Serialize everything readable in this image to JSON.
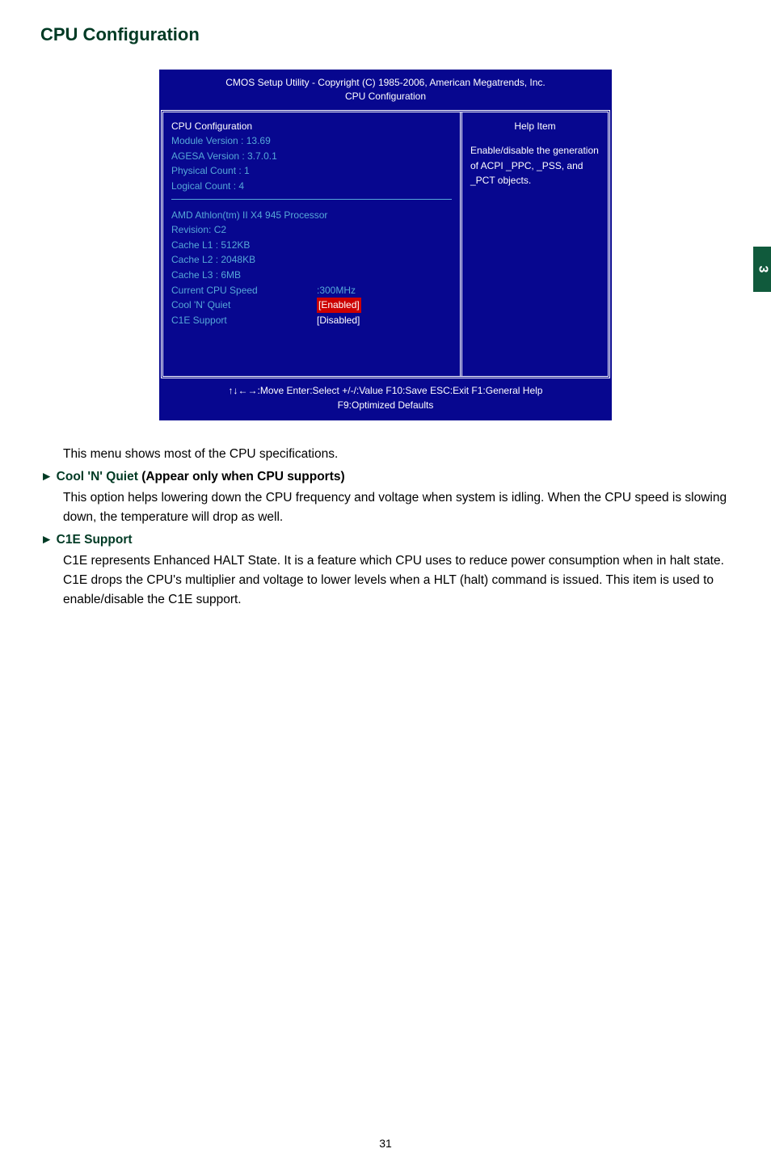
{
  "title": "CPU Configuration",
  "bios": {
    "header_line1": "CMOS Setup Utility - Copyright (C) 1985-2006, American Megatrends, Inc.",
    "header_line2": "CPU Configuration",
    "left": {
      "section_title": "CPU Configuration",
      "module_version": "Module  Version :  13.69",
      "agesa_version": "AGESA  Version :  3.7.0.1",
      "physical_count": "Physical Count :  1",
      "logical_count": "Logical Count :    4",
      "cpu_name": "AMD Athlon(tm) II X4 945 Processor",
      "revision": "Revision: C2",
      "cache_l1": "Cache L1 :  512KB",
      "cache_l2": "Cache L2 :  2048KB",
      "cache_l3": "Cache L3 :  6MB",
      "cur_speed_label": "Current CPU Speed",
      "cur_speed_val": ":300MHz",
      "cool_label": "Cool 'N' Quiet",
      "cool_val": "[Enabled]",
      "c1e_label": "C1E Support",
      "c1e_val": "[Disabled]"
    },
    "right": {
      "help_title": "Help Item",
      "help_text": "Enable/disable the generation of ACPI _PPC, _PSS, and _PCT objects."
    },
    "footer_line1": "↑↓←→:Move   Enter:Select     +/-/:Value    F10:Save     ESC:Exit    F1:General Help",
    "footer_line2": "F9:Optimized Defaults"
  },
  "body": {
    "intro": "This menu shows most of the CPU specifications.",
    "cool_title_prefix": "Cool 'N' Quiet",
    "cool_title_suffix": " (Appear only when CPU supports)",
    "cool_text": "This option helps lowering down the CPU frequency and voltage when system is idling. When the CPU speed is slowing down, the temperature will drop as well.",
    "c1e_title": "C1E Support",
    "c1e_text": "C1E represents Enhanced HALT State. It is a feature which CPU uses to reduce power consumption when in halt state. C1E drops the CPU's multiplier and voltage to lower levels when a HLT (halt) command is issued. This item is used to enable/disable the C1E support."
  },
  "side_tab": "3",
  "page_number": "31",
  "chart_data": {
    "type": "table",
    "title": "CPU Configuration BIOS Screen",
    "info": [
      {
        "label": "Module Version",
        "value": "13.69"
      },
      {
        "label": "AGESA Version",
        "value": "3.7.0.1"
      },
      {
        "label": "Physical Count",
        "value": 1
      },
      {
        "label": "Logical Count",
        "value": 4
      },
      {
        "label": "Processor",
        "value": "AMD Athlon(tm) II X4 945 Processor"
      },
      {
        "label": "Revision",
        "value": "C2"
      },
      {
        "label": "Cache L1",
        "value": "512KB"
      },
      {
        "label": "Cache L2",
        "value": "2048KB"
      },
      {
        "label": "Cache L3",
        "value": "6MB"
      },
      {
        "label": "Current CPU Speed",
        "value": "300MHz"
      }
    ],
    "options": [
      {
        "name": "Cool 'N' Quiet",
        "value": "Enabled"
      },
      {
        "name": "C1E Support",
        "value": "Disabled"
      }
    ],
    "help": "Enable/disable the generation of ACPI _PPC, _PSS, and _PCT objects."
  }
}
